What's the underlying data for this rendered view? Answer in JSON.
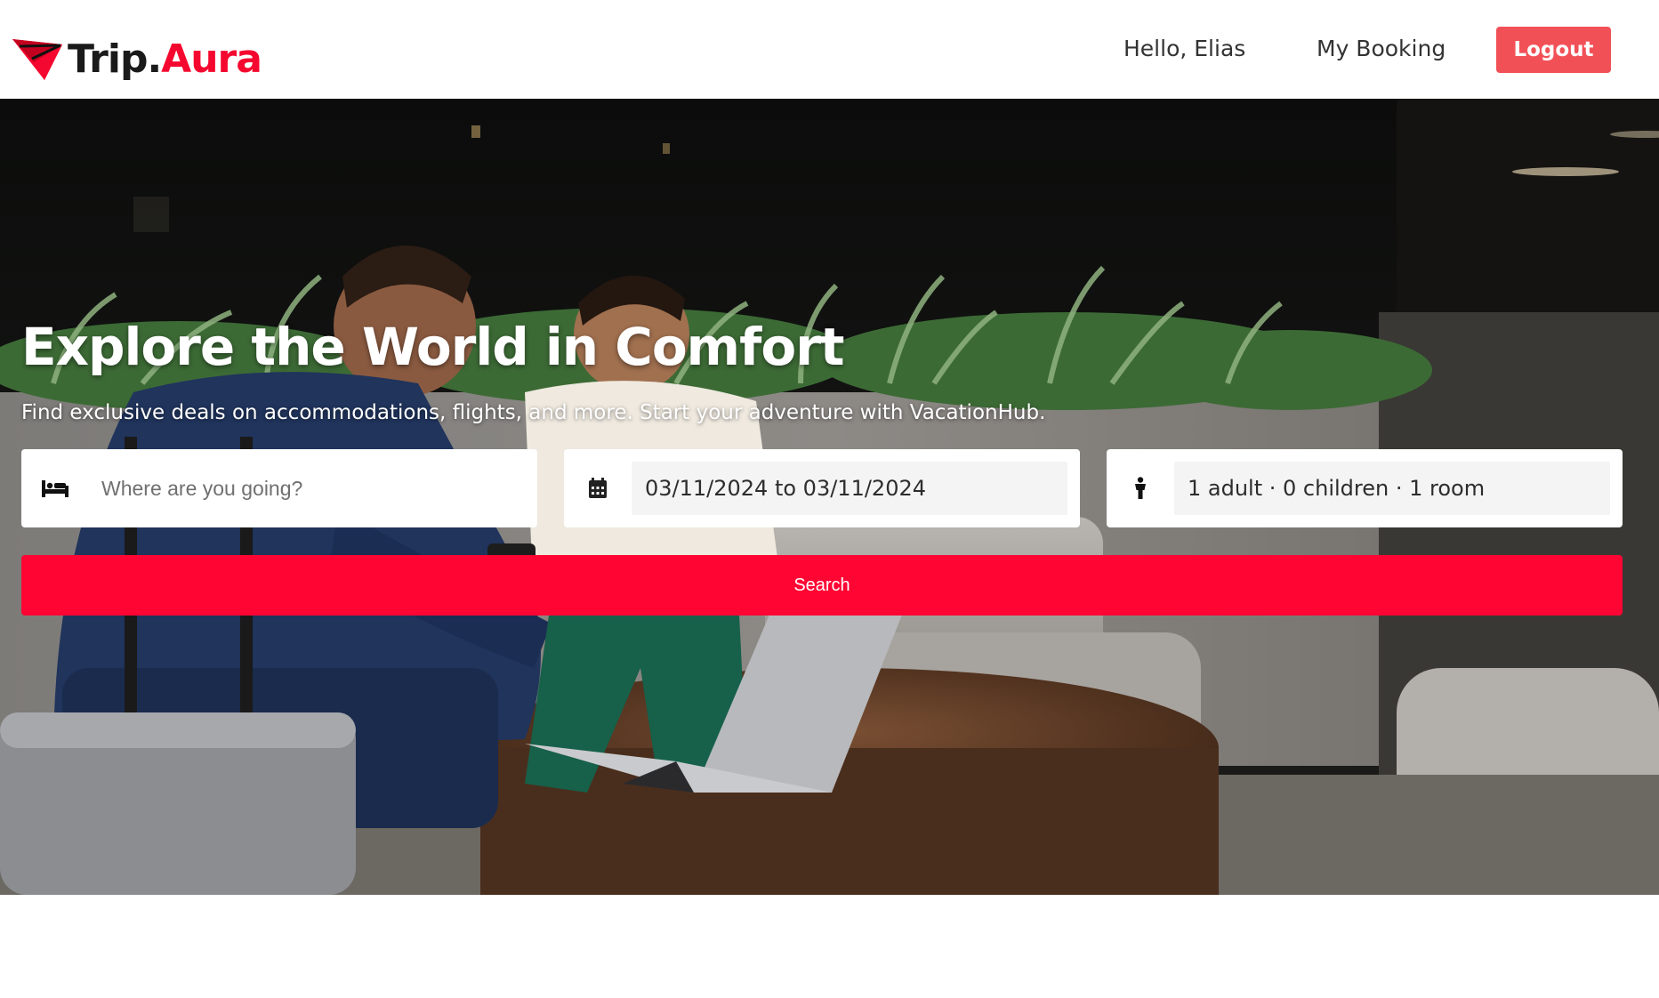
{
  "brand": {
    "name_main": "Trip.",
    "name_accent": "Aura",
    "accent_color": "#f5082f",
    "logo_icon": "paper-plane-icon"
  },
  "nav": {
    "greeting": "Hello, Elias",
    "my_booking": "My Booking",
    "logout": "Logout",
    "logout_color": "#f25057"
  },
  "hero": {
    "title": "Explore the World in Comfort",
    "subtitle": "Find exclusive deals on accommodations, flights, and more. Start your adventure with VacationHub.",
    "image_description": ""
  },
  "search": {
    "destination_icon": "bed-icon",
    "destination_placeholder": "Where are you going?",
    "destination_value": "",
    "date_icon": "calendar-icon",
    "date_range": "03/11/2024 to 03/11/2024",
    "guests_icon": "person-icon",
    "guests": "1 adult · 0 children · 1 room",
    "button_label": "Search",
    "button_color": "#ff0533"
  }
}
